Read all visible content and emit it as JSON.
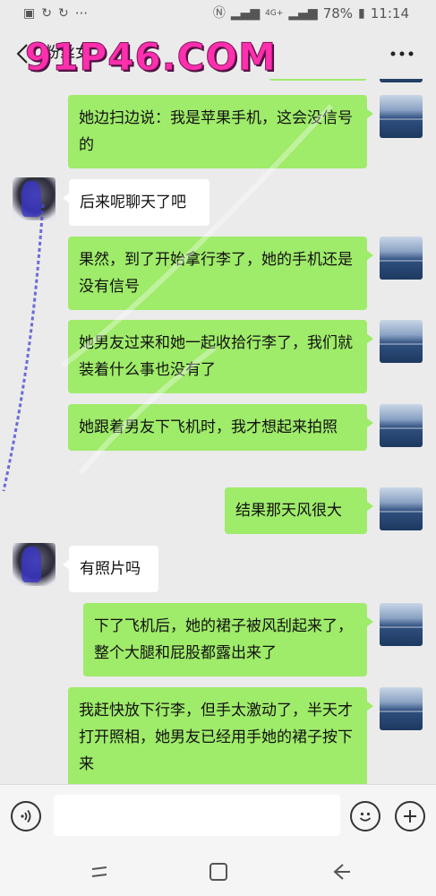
{
  "status_bar": {
    "battery": "78%",
    "time": "11:14",
    "network": "4G+",
    "dots": "···"
  },
  "header": {
    "title": "粉丝女",
    "watermark": "91P46.COM",
    "back_icon": "chevron-left-icon",
    "more_icon": "more-dots-icon"
  },
  "messages": [
    {
      "sender": "me",
      "text": "她边扫边说：我是苹果手机，这会没信号的"
    },
    {
      "sender": "her",
      "text": "后来呢聊天了吧"
    },
    {
      "sender": "me",
      "text": "果然，到了开始拿行李了，她的手机还是没有信号"
    },
    {
      "sender": "me",
      "text": "她男友过来和她一起收拾行李了，我们就装着什么事也没有了"
    },
    {
      "sender": "me",
      "text": "她跟着男友下飞机时，我才想起来拍照"
    },
    {
      "sender": "me",
      "text": "结果那天风很大"
    },
    {
      "sender": "her",
      "text": "有照片吗"
    },
    {
      "sender": "me",
      "text": "下了飞机后，她的裙子被风刮起来了，整个大腿和屁股都露出来了"
    },
    {
      "sender": "me",
      "text": "我赶快放下行李，但手太激动了，半天才打开照相，她男友已经用手她的裙子按下来"
    }
  ],
  "input": {
    "placeholder": "",
    "voice_icon": "voice-icon",
    "emoji_icon": "emoji-icon",
    "plus_icon": "plus-icon"
  },
  "navbar": {
    "recent_icon": "recent-apps-icon",
    "home_icon": "home-icon",
    "back_icon": "back-arrow-icon"
  },
  "colors": {
    "background": "#ebebeb",
    "bubble_green": "#9feb6a",
    "bubble_white": "#ffffff",
    "watermark": "#ff2fae"
  }
}
